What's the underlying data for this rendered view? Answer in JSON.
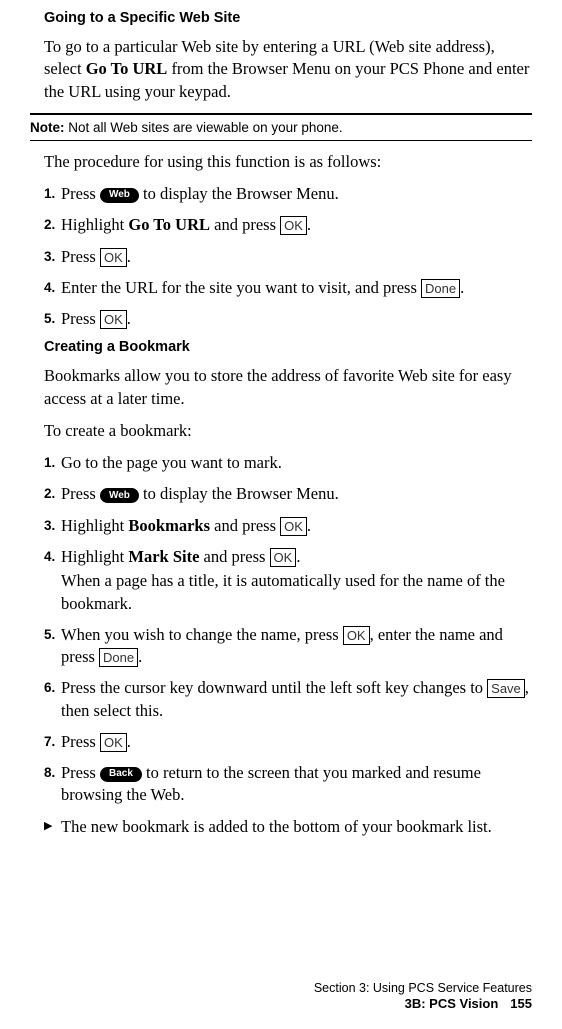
{
  "section1": {
    "heading": "Going to a Specific Web Site",
    "intro_a": "To go to a particular Web site by entering a URL (Web site address), select ",
    "intro_bold": "Go To URL",
    "intro_b": " from the Browser Menu on your PCS Phone and enter the URL using your keypad."
  },
  "note": {
    "label": "Note:",
    "text": " Not all Web sites are viewable on your phone."
  },
  "proc_intro": "The procedure for using this function is as follows:",
  "s1_steps": {
    "1": {
      "num": "1.",
      "a": "Press ",
      "key": "Web",
      "b": " to display the Browser Menu."
    },
    "2": {
      "num": "2.",
      "a": "Highlight ",
      "bold": "Go To URL",
      "b": " and press ",
      "key": "OK",
      "c": "."
    },
    "3": {
      "num": "3.",
      "a": "Press ",
      "key": "OK",
      "b": "."
    },
    "4": {
      "num": "4.",
      "a": "Enter the URL for the site you want to visit, and press ",
      "key": "Done",
      "b": "."
    },
    "5": {
      "num": "5.",
      "a": "Press ",
      "key": "OK",
      "b": "."
    }
  },
  "section2": {
    "heading": "Creating a Bookmark",
    "p1": "Bookmarks allow you to store the address of favorite Web site for easy access at a later time.",
    "p2": "To create a bookmark:"
  },
  "s2_steps": {
    "1": {
      "num": "1.",
      "a": "Go to the page you want to mark."
    },
    "2": {
      "num": "2.",
      "a": "Press ",
      "key": "Web",
      "b": " to display the Browser Menu."
    },
    "3": {
      "num": "3.",
      "a": "Highlight ",
      "bold": "Bookmarks",
      "b": " and press ",
      "key": "OK",
      "c": "."
    },
    "4": {
      "num": "4.",
      "a": "Highlight ",
      "bold": "Mark Site",
      "b": " and press ",
      "key": "OK",
      "c": ".",
      "sub": "When a page has a title, it is automatically used for the name of the bookmark."
    },
    "5": {
      "num": "5.",
      "a": "When you wish to change the name, press ",
      "key1": "OK",
      "b": ", enter the name and press ",
      "key2": "Done",
      "c": "."
    },
    "6": {
      "num": "6.",
      "a": "Press the cursor key downward until the left soft key changes to ",
      "key": "Save",
      "b": ", then select this."
    },
    "7": {
      "num": "7.",
      "a": "Press ",
      "key": "OK",
      "b": "."
    },
    "8": {
      "num": "8.",
      "a": "Press ",
      "key": "Back",
      "b": " to return to the screen that you marked and resume browsing the Web."
    }
  },
  "bullet": "The new bookmark is added to the bottom of your bookmark list.",
  "footer": {
    "line1": "Section 3: Using PCS Service Features",
    "line2a": "3B: PCS Vision",
    "pagenum": "155"
  }
}
